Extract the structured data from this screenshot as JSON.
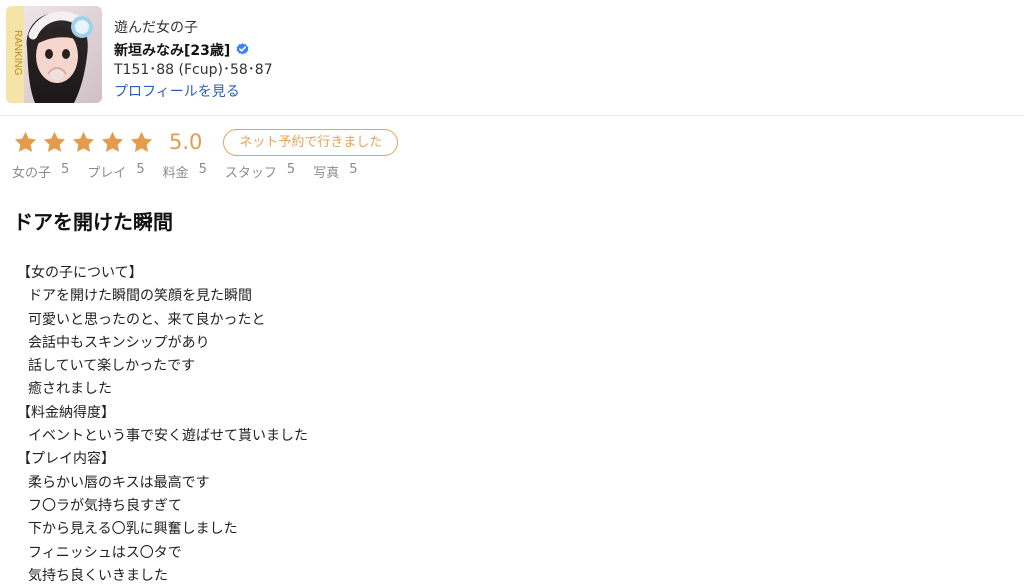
{
  "profile": {
    "heading": "遊んだ女の子",
    "name": "新垣みなみ[23歳]",
    "stats": "T151･88 (Fcup)･58･87",
    "profile_link": "プロフィールを見る",
    "avatar_icon": "profile-photo",
    "verified_icon": "verified-check-icon",
    "ranking_text": "RANKING"
  },
  "rating": {
    "stars": 5,
    "score": "5.0",
    "badge": "ネット予約で行きました",
    "star_color": "#e59b4c",
    "badge_color": "#e8a15a",
    "categories": [
      {
        "label": "女の子",
        "value": "5"
      },
      {
        "label": "プレイ",
        "value": "5"
      },
      {
        "label": "料金",
        "value": "5"
      },
      {
        "label": "スタッフ",
        "value": "5"
      },
      {
        "label": "写真",
        "value": "5"
      }
    ]
  },
  "review": {
    "title": "ドアを開けた瞬間",
    "lines": [
      "【女の子について】",
      "ドアを開けた瞬間の笑顔を見た瞬間",
      "可愛いと思ったのと、来て良かったと",
      "会話中もスキンシップがあり",
      "話していて楽しかったです",
      "癒されました",
      "【料金納得度】",
      "イベントという事で安く遊ばせて貰いました",
      "【プレイ内容】",
      "柔らかい唇のキスは最高です",
      "フ〇ラが気持ち良すぎて",
      "下から見える〇乳に興奮しました",
      "フィニッシュはス〇タで",
      "気持ち良くいきました"
    ]
  },
  "colors": {
    "link": "#2b5fb5",
    "muted_text": "#8b8b8b",
    "divider": "#e8e8e8"
  }
}
